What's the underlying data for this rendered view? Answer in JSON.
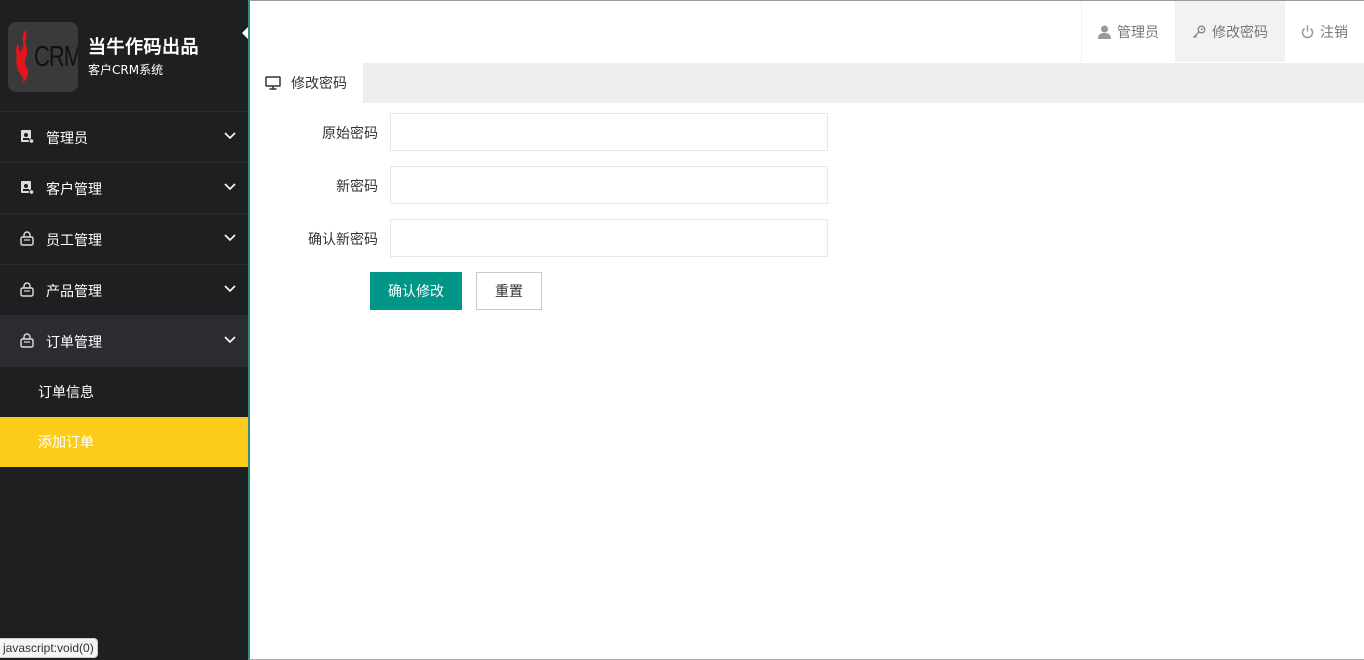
{
  "brand": {
    "logo_text": "CRM",
    "title": "当牛作码出品",
    "subtitle": "客户CRM系统"
  },
  "sidebar": {
    "items": [
      {
        "label": "管理员",
        "icon": "id-card-icon"
      },
      {
        "label": "客户管理",
        "icon": "id-card-icon"
      },
      {
        "label": "员工管理",
        "icon": "basket-icon"
      },
      {
        "label": "产品管理",
        "icon": "basket-icon"
      },
      {
        "label": "订单管理",
        "icon": "basket-icon",
        "expanded": true,
        "children": [
          {
            "label": "订单信息"
          },
          {
            "label": "添加订单",
            "current": true
          }
        ]
      }
    ]
  },
  "topbar": {
    "admin_label": "管理员",
    "change_password_label": "修改密码",
    "logout_label": "注销"
  },
  "tab": {
    "label": "修改密码"
  },
  "form": {
    "old_password_label": "原始密码",
    "old_password_value": "",
    "new_password_label": "新密码",
    "new_password_value": "",
    "confirm_password_label": "确认新密码",
    "confirm_password_value": "",
    "submit_label": "确认修改",
    "reset_label": "重置"
  },
  "status_bar": {
    "text": "javascript:void(0)"
  },
  "colors": {
    "sidebar_bg": "#1e1f21",
    "current_item": "#fbcd1a",
    "primary_button": "#009688",
    "accent_border": "#2f8e7e"
  }
}
